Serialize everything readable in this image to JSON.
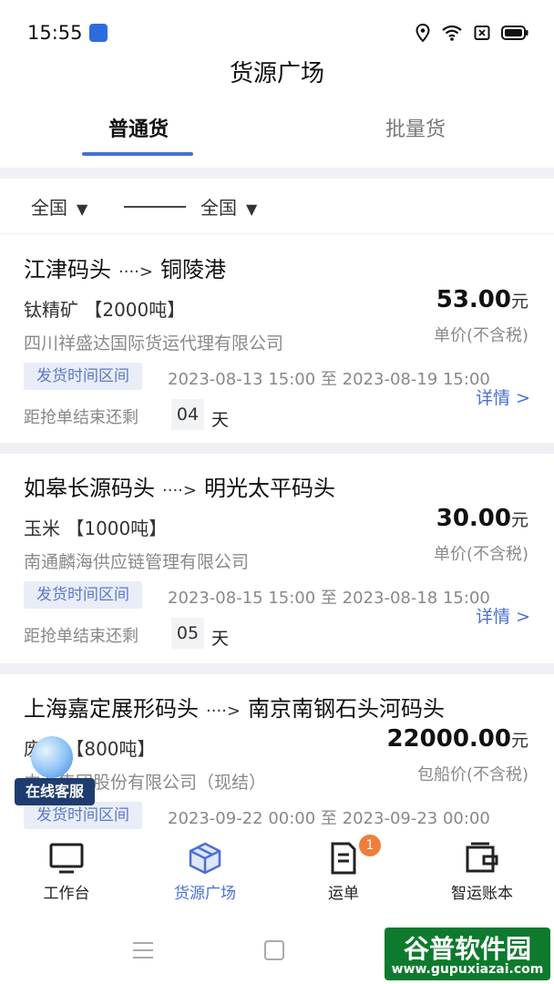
{
  "status_bar": {
    "time": "15:55"
  },
  "header": {
    "title": "货源广场"
  },
  "tabs": [
    {
      "label": "普通货"
    },
    {
      "label": "批量货"
    }
  ],
  "filter": {
    "from": "全国",
    "to": "全国"
  },
  "cards": [
    {
      "origin": "江津码头",
      "destination": "铜陵港",
      "cargo": "钛精矿",
      "tonnage": "【2000吨】",
      "company": "四川祥盛达国际货运代理有限公司",
      "price": "53.00",
      "price_unit": "元",
      "price_note": "单价(不含税)",
      "time_badge": "发货时间区间",
      "time_range": "2023-08-13 15:00 至 2023-08-19 15:00",
      "details": "详情",
      "countdown_label": "距抢单结束还剩",
      "days": "04",
      "days_unit": "天"
    },
    {
      "origin": "如皋长源码头",
      "destination": "明光太平码头",
      "cargo": "玉米",
      "tonnage": "【1000吨】",
      "company": "南通麟海供应链管理有限公司",
      "price": "30.00",
      "price_unit": "元",
      "price_note": "单价(不含税)",
      "time_badge": "发货时间区间",
      "time_range": "2023-08-15 15:00 至 2023-08-18 15:00",
      "details": "详情",
      "countdown_label": "距抢单结束还剩",
      "days": "05",
      "days_unit": "天"
    },
    {
      "origin": "上海嘉定展形码头",
      "destination": "南京南钢石头河码头",
      "cargo": "废钢",
      "tonnage": "【800吨】",
      "company": "中石集团股份有限公司（现结）",
      "price": "22000.00",
      "price_unit": "元",
      "price_note": "包船价(不含税)",
      "time_badge": "发货时间区间",
      "time_range": "2023-09-22 00:00 至 2023-09-23 00:00"
    }
  ],
  "chat_float": {
    "label": "在线客服"
  },
  "bottom_nav": [
    {
      "label": "工作台",
      "icon": "monitor-icon"
    },
    {
      "label": "货源广场",
      "icon": "box-icon"
    },
    {
      "label": "运单",
      "icon": "document-icon",
      "badge": "1"
    },
    {
      "label": "智运账本",
      "icon": "wallet-icon"
    }
  ],
  "watermark": {
    "top": "谷普软件园",
    "bottom": "www.gupuxiazai.com"
  },
  "colors": {
    "accent": "#4a6fd6",
    "badge": "#f07d3b",
    "muted": "#8a8a8a"
  }
}
